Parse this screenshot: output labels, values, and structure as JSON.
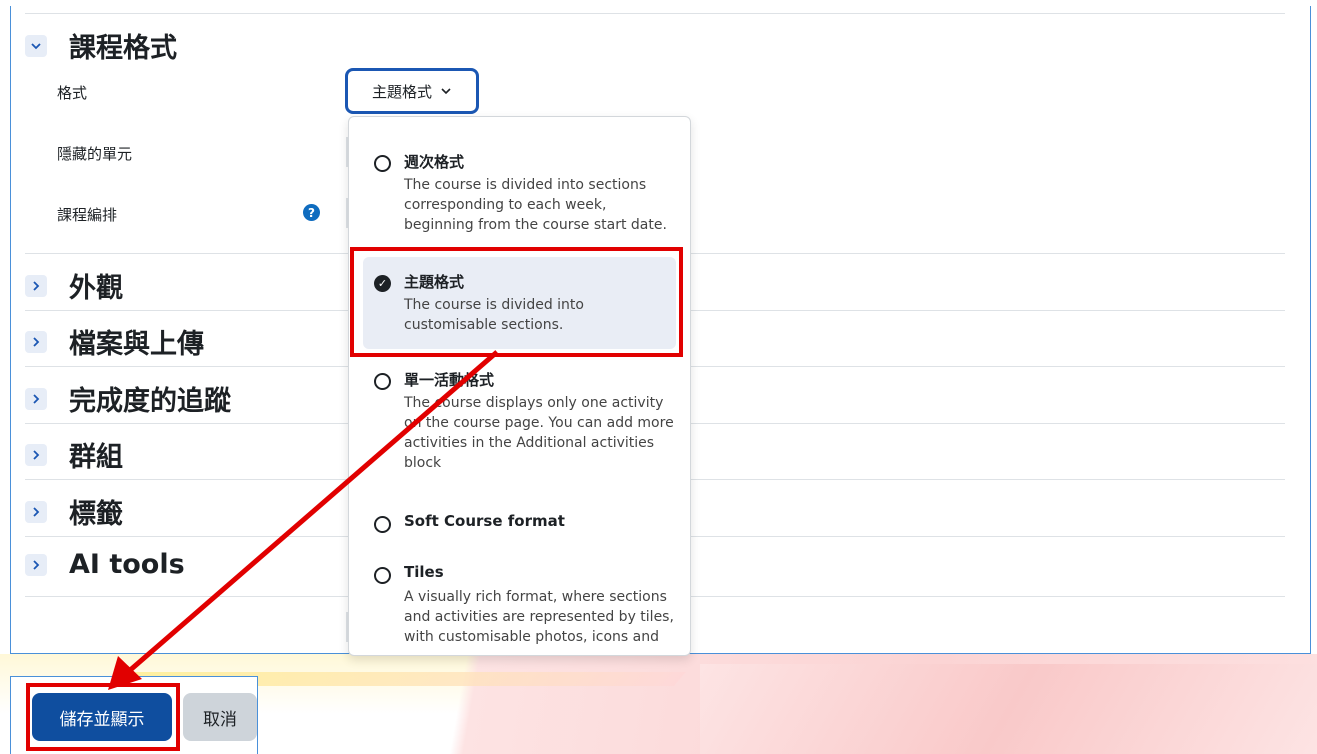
{
  "course_format": {
    "section_title": "課程格式",
    "fields": {
      "format_label": "格式",
      "hidden_sections_label": "隱藏的單元",
      "course_layout_label": "課程編排"
    },
    "help_glyph": "?",
    "selected_format": "主題格式",
    "options": [
      {
        "name": "週次格式",
        "desc": "The course is divided into sections corresponding to each week, beginning from the course start date.",
        "selected": false
      },
      {
        "name": "主題格式",
        "desc": "The course is divided into customisable sections.",
        "selected": true
      },
      {
        "name": "單一活動格式",
        "desc": "The course displays only one activity on the course page. You can add more activities in the Additional activities block",
        "selected": false
      },
      {
        "name": "Soft Course format",
        "desc": "",
        "selected": false
      },
      {
        "name": "Tiles",
        "desc": "A visually rich format, where sections and activities are represented by tiles, with customisable photos, icons and",
        "selected": false
      }
    ]
  },
  "collapsed_sections": [
    "外觀",
    "檔案與上傳",
    "完成度的追蹤",
    "群組",
    "標籤",
    "AI tools"
  ],
  "buttons": {
    "save": "儲存並顯示",
    "cancel": "取消"
  },
  "colors": {
    "primary": "#0f4e9f",
    "annotation_red": "#e10000",
    "select_border": "#1b57b3"
  }
}
